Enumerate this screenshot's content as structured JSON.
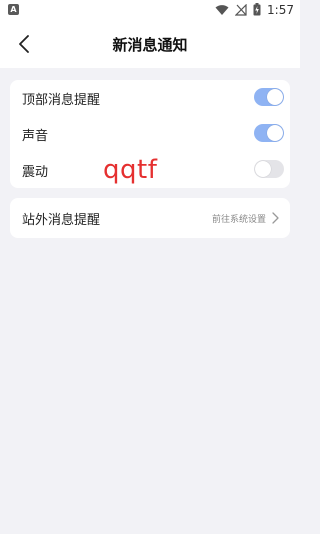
{
  "status_bar": {
    "time": "1:57",
    "left_icon": "a-app-icon",
    "icons": [
      "wifi-icon",
      "signal-off-icon",
      "battery-charging-icon"
    ]
  },
  "header": {
    "title": "新消息通知",
    "back_icon": "chevron-left-icon"
  },
  "settings_group": {
    "rows": [
      {
        "label": "顶部消息提醒",
        "toggle_on": true
      },
      {
        "label": "声音",
        "toggle_on": true
      },
      {
        "label": "震动",
        "toggle_on": false
      }
    ]
  },
  "external_notifications": {
    "label": "站外消息提醒",
    "value": "前往系统设置"
  },
  "watermark": "qqtf",
  "colors": {
    "background": "#f2f2f6",
    "toggle_on": "#8fb3f3",
    "toggle_off": "#e4e4e8",
    "watermark": "#e53030"
  }
}
